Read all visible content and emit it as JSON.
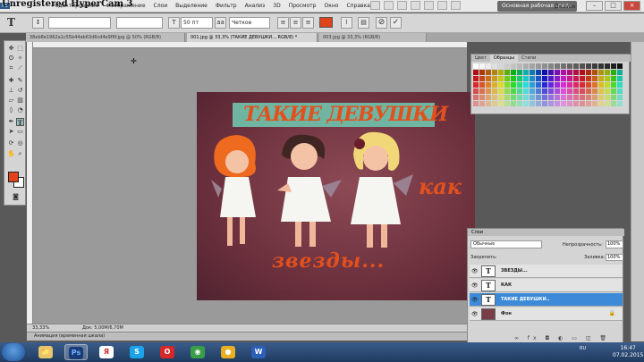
{
  "watermark": "Unregistered HyperCam 3",
  "menu": {
    "ps_badge": "Ps",
    "items": [
      "Редактирование",
      "Изображение",
      "Слои",
      "Выделение",
      "Фильтр",
      "Анализ",
      "3D",
      "Просмотр",
      "Окно",
      "Справка"
    ],
    "workspace": "Основная рабочая среда",
    "design": "Дизайн"
  },
  "options": {
    "font_family": "",
    "font_style": "",
    "font_size": "50 пт",
    "antialias": "Четкое",
    "aa_prefix": "aa"
  },
  "tabs": [
    {
      "label": "38eb8e1962a1c55b44ab63d6cd4e9f6f.jpg @ 50% (RGB/8)",
      "active": false
    },
    {
      "label": "001.jpg @ 33,3% (ТАКИЕ ДЕВУШКИ.., RGB/8) *",
      "active": true
    },
    {
      "label": "003.jpg @ 33,3% (RGB/8)",
      "active": false
    }
  ],
  "image": {
    "title": "ТАКИЕ ДЕВУШКИ",
    "kak": "как",
    "zvezdy": "звезды..."
  },
  "status": {
    "zoom": "33,33%",
    "doc": "Док: 5,00M/6,70M",
    "animation": "Анимация (временная шкала)"
  },
  "swatch_panel": {
    "tabs": [
      "Цвет",
      "Образцы",
      "Стили"
    ],
    "active_tab": "Образцы"
  },
  "layers": {
    "tab": "Слои",
    "blend": "Обычные",
    "opacity_label": "Непрозрачность:",
    "opacity": "100%",
    "lock_label": "Закрепить:",
    "fill_label": "Заливка:",
    "fill": "100%",
    "items": [
      {
        "name": "ЗВЕЗДЫ...",
        "type": "text",
        "thumb": "T",
        "selected": false
      },
      {
        "name": "КАК",
        "type": "text",
        "thumb": "T",
        "selected": false
      },
      {
        "name": "ТАКИЕ ДЕВУШКИ..",
        "type": "text",
        "thumb": "T",
        "selected": true
      },
      {
        "name": "Фон",
        "type": "image",
        "thumb": "",
        "selected": false
      }
    ],
    "footer": "∞ fx ◘ ◐ ▭ ◫ 🗑"
  },
  "taskbar": {
    "apps": [
      {
        "name": "explorer-app",
        "glyph": "📁"
      },
      {
        "name": "photoshop-app",
        "glyph": "Ps",
        "active": true
      },
      {
        "name": "yandex-app",
        "glyph": "Я"
      },
      {
        "name": "skype-app",
        "glyph": "S"
      },
      {
        "name": "opera-app",
        "glyph": "O"
      },
      {
        "name": "chrome-app",
        "glyph": "◉"
      },
      {
        "name": "paint-app",
        "glyph": "●"
      },
      {
        "name": "word-app",
        "glyph": "W"
      }
    ],
    "tray_lang": "RU",
    "time": "16:47",
    "date": "07.02.2015"
  },
  "colors": {
    "accent_orange": "#e2501e",
    "title_band": "#6fb5a1",
    "layer_selected": "#3c8ad8"
  }
}
